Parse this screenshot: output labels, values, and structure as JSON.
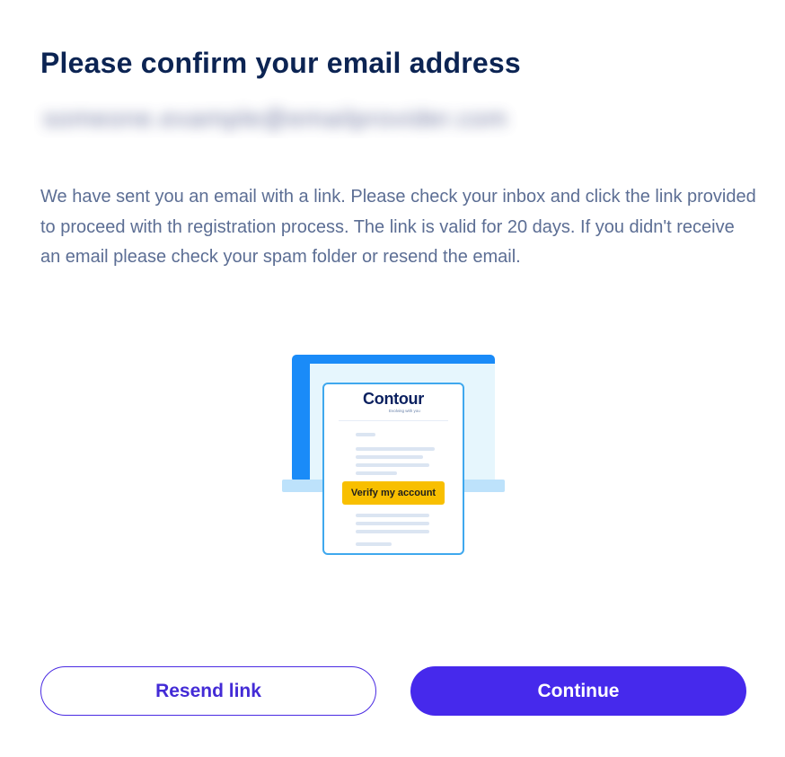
{
  "page": {
    "title": "Please confirm your email address",
    "email_redacted": "someone.example@emailprovider.com",
    "description": "We have sent you an email with a link. Please check your inbox and click the link provided to proceed with th registration process. The link is valid for 20 days. If you didn't receive an email please check your spam folder or resend the email."
  },
  "illustration": {
    "brand": "Contour",
    "brand_tagline": "Evolving with you",
    "verify_label": "Verify my account",
    "icon": "laptop-email-icon"
  },
  "actions": {
    "resend_label": "Resend link",
    "continue_label": "Continue"
  },
  "colors": {
    "title": "#0c2453",
    "body_text": "#5c6e94",
    "primary": "#4629ec",
    "verify_button": "#f8bf00",
    "laptop_frame": "#1a8bf8"
  }
}
